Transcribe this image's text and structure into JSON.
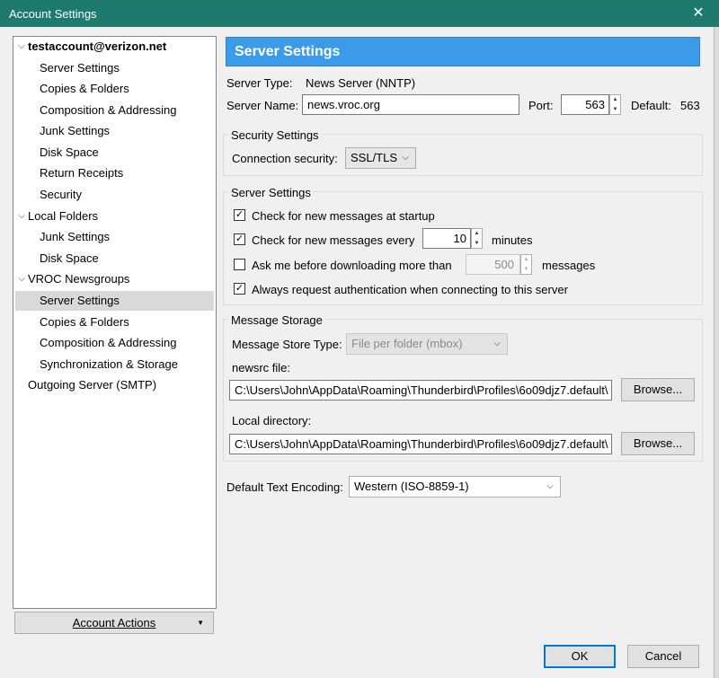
{
  "window": {
    "title": "Account Settings",
    "close": "✕"
  },
  "tree": {
    "items": [
      {
        "label": "testaccount@verizon.net"
      },
      {
        "label": "Server Settings"
      },
      {
        "label": "Copies & Folders"
      },
      {
        "label": "Composition & Addressing"
      },
      {
        "label": "Junk Settings"
      },
      {
        "label": "Disk Space"
      },
      {
        "label": "Return Receipts"
      },
      {
        "label": "Security"
      },
      {
        "label": "Local Folders"
      },
      {
        "label": "Junk Settings"
      },
      {
        "label": "Disk Space"
      },
      {
        "label": "VROC Newsgroups"
      },
      {
        "label": "Server Settings"
      },
      {
        "label": "Copies & Folders"
      },
      {
        "label": "Composition & Addressing"
      },
      {
        "label": "Synchronization & Storage"
      },
      {
        "label": "Outgoing Server (SMTP)"
      }
    ],
    "selected_index": 12
  },
  "account_actions": {
    "label": "Account Actions",
    "arrow": "▼"
  },
  "header": {
    "title": "Server Settings"
  },
  "server": {
    "type_label": "Server Type:",
    "type_value": "News Server (NNTP)",
    "name_label": "Server Name:",
    "name_value": "news.vroc.org",
    "port_label": "Port:",
    "port_value": "563",
    "default_label": "Default:",
    "default_value": "563"
  },
  "security": {
    "group_title": "Security Settings",
    "connection_label": "Connection security:",
    "connection_value": "SSL/TLS"
  },
  "server_settings": {
    "group_title": "Server Settings",
    "check_startup": {
      "label": "Check for new messages at startup",
      "checked": true
    },
    "check_every": {
      "label": "Check for new messages every",
      "checked": true,
      "value": "10",
      "unit": "minutes"
    },
    "ask_before": {
      "label": "Ask me before downloading more than",
      "checked": false,
      "value": "500",
      "unit": "messages"
    },
    "always_auth": {
      "label": "Always request authentication when connecting to this server",
      "checked": true
    }
  },
  "storage": {
    "group_title": "Message Storage",
    "store_type_label": "Message Store Type:",
    "store_type_value": "File per folder (mbox)",
    "newsrc_label": "newsrc file:",
    "newsrc_value": "C:\\Users\\John\\AppData\\Roaming\\Thunderbird\\Profiles\\6o09djz7.default\\",
    "local_dir_label": "Local directory:",
    "local_dir_value": "C:\\Users\\John\\AppData\\Roaming\\Thunderbird\\Profiles\\6o09djz7.default\\",
    "browse_label": "Browse..."
  },
  "encoding": {
    "label": "Default Text Encoding:",
    "value": "Western (ISO-8859-1)"
  },
  "buttons": {
    "ok": "OK",
    "cancel": "Cancel"
  },
  "icons": {
    "check": "✓",
    "caret": "⌵",
    "spin_up": "▲",
    "spin_down": "▼",
    "expanded": "⌵"
  }
}
